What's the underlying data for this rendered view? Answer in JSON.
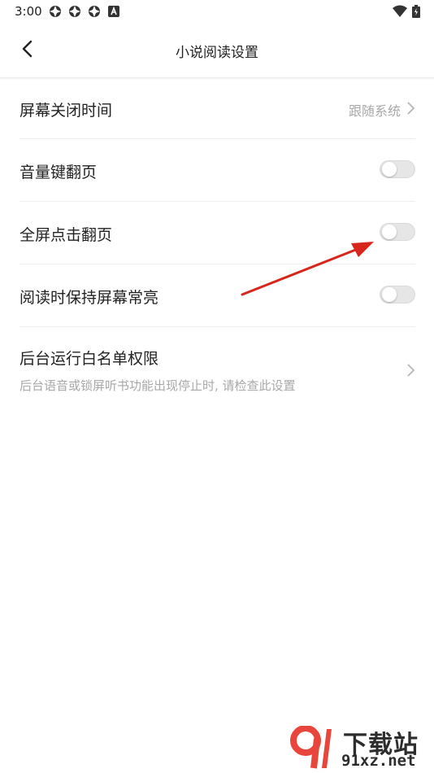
{
  "status_bar": {
    "time": "3:00"
  },
  "header": {
    "title": "小说阅读设置"
  },
  "settings": [
    {
      "label": "屏幕关闭时间",
      "value": "跟随系统"
    },
    {
      "label": "音量键翻页",
      "toggle_on": false
    },
    {
      "label": "全屏点击翻页",
      "toggle_on": false
    },
    {
      "label": "阅读时保持屏幕常亮",
      "toggle_on": false
    },
    {
      "label": "后台运行白名单权限",
      "description": "后台语音或锁屏听书功能出现停止时, 请检查此设置"
    }
  ],
  "annotation": {
    "color": "#d9261c"
  },
  "watermark": {
    "brand": "下载站",
    "url": "91xz.net"
  },
  "colors": {
    "toggle_off": "#e6e6e6",
    "muted_text": "#a8a8a8",
    "watermark_red": "#e8453c"
  }
}
